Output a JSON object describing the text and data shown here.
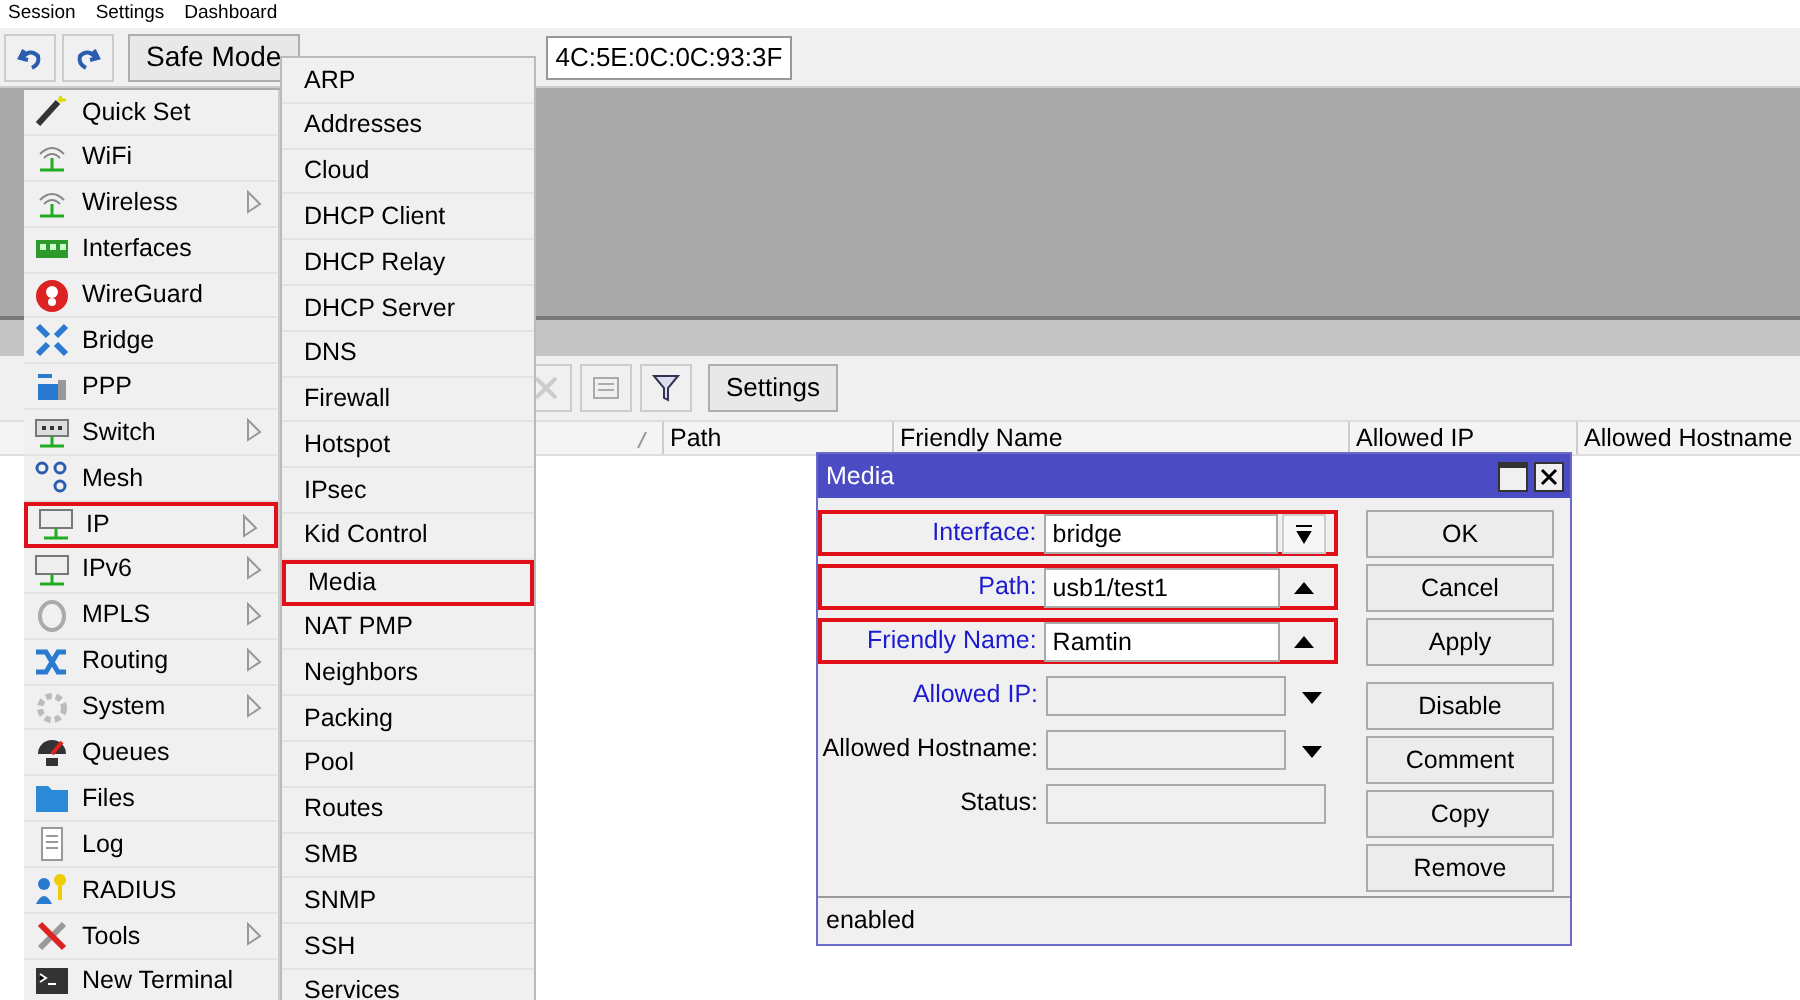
{
  "menu_bar": [
    "Session",
    "Settings",
    "Dashboard"
  ],
  "toolbar": {
    "safe_mode": "Safe Mode",
    "session_value": "4C:5E:0C:0C:93:3F"
  },
  "main_menu": [
    {
      "label": "Quick Set",
      "has_submenu": false,
      "highlighted": false
    },
    {
      "label": "WiFi",
      "has_submenu": false,
      "highlighted": false
    },
    {
      "label": "Wireless",
      "has_submenu": true,
      "highlighted": false
    },
    {
      "label": "Interfaces",
      "has_submenu": false,
      "highlighted": false
    },
    {
      "label": "WireGuard",
      "has_submenu": false,
      "highlighted": false
    },
    {
      "label": "Bridge",
      "has_submenu": false,
      "highlighted": false
    },
    {
      "label": "PPP",
      "has_submenu": false,
      "highlighted": false
    },
    {
      "label": "Switch",
      "has_submenu": true,
      "highlighted": false
    },
    {
      "label": "Mesh",
      "has_submenu": false,
      "highlighted": false
    },
    {
      "label": "IP",
      "has_submenu": true,
      "highlighted": true
    },
    {
      "label": "IPv6",
      "has_submenu": true,
      "highlighted": false
    },
    {
      "label": "MPLS",
      "has_submenu": true,
      "highlighted": false
    },
    {
      "label": "Routing",
      "has_submenu": true,
      "highlighted": false
    },
    {
      "label": "System",
      "has_submenu": true,
      "highlighted": false
    },
    {
      "label": "Queues",
      "has_submenu": false,
      "highlighted": false
    },
    {
      "label": "Files",
      "has_submenu": false,
      "highlighted": false
    },
    {
      "label": "Log",
      "has_submenu": false,
      "highlighted": false
    },
    {
      "label": "RADIUS",
      "has_submenu": false,
      "highlighted": false
    },
    {
      "label": "Tools",
      "has_submenu": true,
      "highlighted": false
    },
    {
      "label": "New Terminal",
      "has_submenu": false,
      "highlighted": false
    }
  ],
  "ip_submenu": [
    {
      "label": "ARP",
      "highlighted": false
    },
    {
      "label": "Addresses",
      "highlighted": false
    },
    {
      "label": "Cloud",
      "highlighted": false
    },
    {
      "label": "DHCP Client",
      "highlighted": false
    },
    {
      "label": "DHCP Relay",
      "highlighted": false
    },
    {
      "label": "DHCP Server",
      "highlighted": false
    },
    {
      "label": "DNS",
      "highlighted": false
    },
    {
      "label": "Firewall",
      "highlighted": false
    },
    {
      "label": "Hotspot",
      "highlighted": false
    },
    {
      "label": "IPsec",
      "highlighted": false
    },
    {
      "label": "Kid Control",
      "highlighted": false
    },
    {
      "label": "Media",
      "highlighted": true
    },
    {
      "label": "NAT PMP",
      "highlighted": false
    },
    {
      "label": "Neighbors",
      "highlighted": false
    },
    {
      "label": "Packing",
      "highlighted": false
    },
    {
      "label": "Pool",
      "highlighted": false
    },
    {
      "label": "Routes",
      "highlighted": false
    },
    {
      "label": "SMB",
      "highlighted": false
    },
    {
      "label": "SNMP",
      "highlighted": false
    },
    {
      "label": "SSH",
      "highlighted": false
    },
    {
      "label": "Services",
      "highlighted": false
    }
  ],
  "list_window": {
    "settings_button": "Settings",
    "columns": [
      "Path",
      "Friendly Name",
      "Allowed IP",
      "Allowed Hostname"
    ]
  },
  "dialog": {
    "title": "Media",
    "fields": [
      {
        "label": "Interface:",
        "value": "bridge",
        "blue_label": true,
        "disabled": false,
        "highlighted": true,
        "kind": "dropdown"
      },
      {
        "label": "Path:",
        "value": "usb1/test1",
        "blue_label": true,
        "disabled": false,
        "highlighted": true,
        "kind": "up"
      },
      {
        "label": "Friendly Name:",
        "value": "Ramtin",
        "blue_label": true,
        "disabled": false,
        "highlighted": true,
        "kind": "up"
      },
      {
        "label": "Allowed IP:",
        "blue_label": true,
        "disabled": true,
        "highlighted": false,
        "kind": "down"
      },
      {
        "label": "Allowed Hostname:",
        "blue_label": false,
        "disabled": true,
        "highlighted": false,
        "kind": "down"
      },
      {
        "label": "Status:",
        "blue_label": false,
        "disabled": true,
        "highlighted": false,
        "kind": "plain"
      }
    ],
    "buttons": [
      {
        "label": "OK",
        "group_start": false
      },
      {
        "label": "Cancel",
        "group_start": false
      },
      {
        "label": "Apply",
        "group_start": false
      },
      {
        "label": "Disable",
        "group_start": true
      },
      {
        "label": "Comment",
        "group_start": false
      },
      {
        "label": "Copy",
        "group_start": false
      },
      {
        "label": "Remove",
        "group_start": false
      }
    ],
    "status": "enabled"
  }
}
